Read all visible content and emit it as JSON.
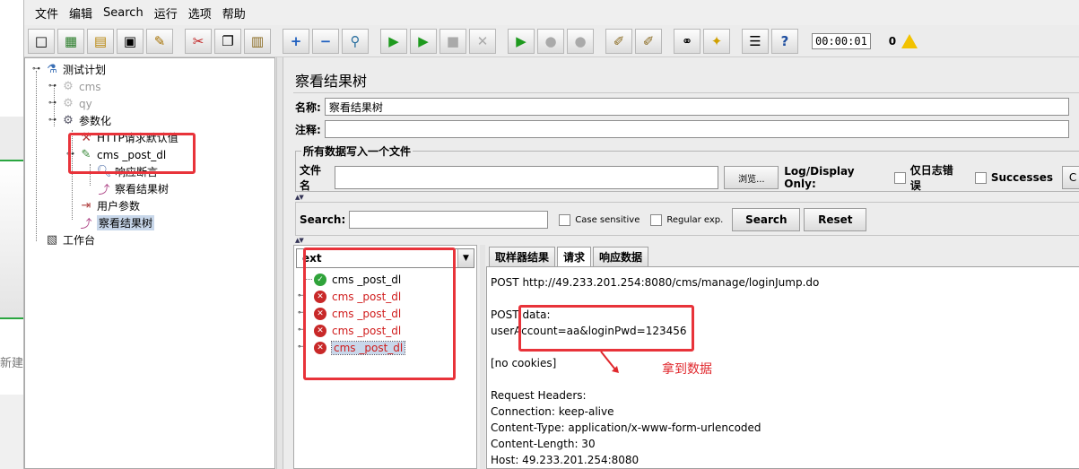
{
  "background": {
    "partial_text": "新建"
  },
  "menu": [
    "文件",
    "编辑",
    "Search",
    "运行",
    "选项",
    "帮助"
  ],
  "toolbar": {
    "buttons": [
      {
        "name": "new",
        "glyph": "□"
      },
      {
        "name": "templates",
        "glyph": "▦"
      },
      {
        "name": "open",
        "glyph": "▤"
      },
      {
        "name": "save",
        "glyph": "▣"
      },
      {
        "name": "save-as",
        "glyph": "✎"
      },
      {
        "name": "cut",
        "glyph": "✂"
      },
      {
        "name": "copy",
        "glyph": "❐"
      },
      {
        "name": "paste",
        "glyph": "▥"
      },
      {
        "name": "expand",
        "glyph": "+"
      },
      {
        "name": "collapse",
        "glyph": "−"
      },
      {
        "name": "toggle",
        "glyph": "⚲"
      },
      {
        "name": "start",
        "glyph": "▶"
      },
      {
        "name": "start-no-pause",
        "glyph": "▶"
      },
      {
        "name": "stop",
        "glyph": "■"
      },
      {
        "name": "shutdown",
        "glyph": "✕"
      },
      {
        "name": "remote-start",
        "glyph": "▶"
      },
      {
        "name": "remote-stop",
        "glyph": "●"
      },
      {
        "name": "remote-shutdown",
        "glyph": "●"
      },
      {
        "name": "clear",
        "glyph": "✐"
      },
      {
        "name": "clear-all",
        "glyph": "✐"
      },
      {
        "name": "search",
        "glyph": "⚭"
      },
      {
        "name": "reset-search",
        "glyph": "✦"
      },
      {
        "name": "function-helper",
        "glyph": "☰"
      },
      {
        "name": "help",
        "glyph": "?"
      }
    ],
    "timer": "00:00:01",
    "error_count": "0"
  },
  "tree": {
    "items": [
      {
        "label": "测试计划"
      },
      {
        "label": "cms"
      },
      {
        "label": "qy"
      },
      {
        "label": "参数化"
      },
      {
        "label": "HTTP请求默认值"
      },
      {
        "label": "cms _post_dl"
      },
      {
        "label": "响应断言"
      },
      {
        "label": "察看结果树"
      },
      {
        "label": "用户参数"
      },
      {
        "label": "察看结果树"
      },
      {
        "label": "工作台"
      }
    ]
  },
  "panel": {
    "title": "察看结果树",
    "name_label": "名称:",
    "name_value": "察看结果树",
    "comment_label": "注释:",
    "comment_value": "",
    "file_group_title": "所有数据写入一个文件",
    "filename_label": "文件名",
    "filename_value": "",
    "browse_button": "浏览...",
    "log_display_label": "Log/Display Only:",
    "errors_only_label": "仅日志错误",
    "successes_label": "Successes",
    "configure_button": "C"
  },
  "search": {
    "label": "Search:",
    "value": "",
    "case_sensitive": "Case sensitive",
    "regex": "Regular exp.",
    "search_button": "Search",
    "reset_button": "Reset"
  },
  "results": {
    "renderer": "ext",
    "items": [
      {
        "label": "cms _post_dl",
        "status": "ok"
      },
      {
        "label": "cms _post_dl",
        "status": "fail"
      },
      {
        "label": "cms _post_dl",
        "status": "fail"
      },
      {
        "label": "cms _post_dl",
        "status": "fail"
      },
      {
        "label": "cms _post_dl",
        "status": "fail"
      }
    ]
  },
  "tabs": [
    "取样器结果",
    "请求",
    "响应数据"
  ],
  "request_lines": [
    "POST http://49.233.201.254:8080/cms/manage/loginJump.do",
    "",
    "POST data:",
    "userAccount=aa&loginPwd=123456",
    "",
    "[no cookies]",
    "",
    "Request Headers:",
    "Connection: keep-alive",
    "Content-Type: application/x-www-form-urlencoded",
    "Content-Length: 30",
    "Host: 49.233.201.254:8080"
  ],
  "annotation": {
    "text": "拿到数据",
    "color": "#e8333a"
  }
}
